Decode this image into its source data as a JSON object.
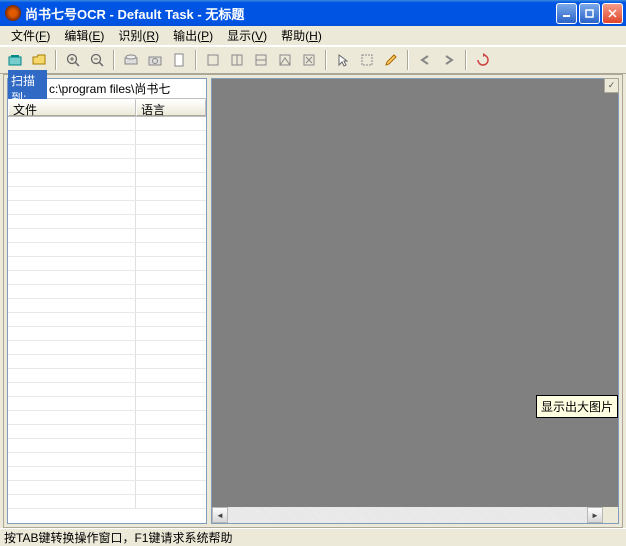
{
  "window": {
    "title": "尚书七号OCR - Default Task - 无标题"
  },
  "menu": {
    "file": "文件",
    "file_u": "F",
    "edit": "编辑",
    "edit_u": "E",
    "recog": "识别",
    "recog_u": "R",
    "output": "输出",
    "output_u": "P",
    "view": "显示",
    "view_u": "V",
    "help": "帮助",
    "help_u": "H"
  },
  "scan": {
    "label": "扫描到:",
    "path": "c:\\program files\\尚书七"
  },
  "columns": {
    "file": "文件",
    "lang": "语言"
  },
  "tooltip": "显示出大图片",
  "status": "按TAB键转换操作窗口，F1键请求系统帮助"
}
